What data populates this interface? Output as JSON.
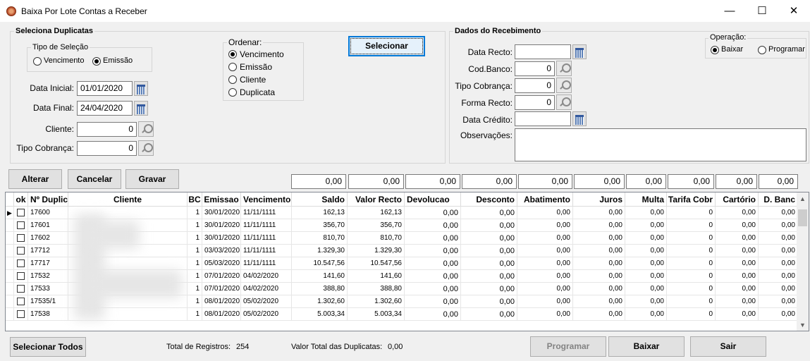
{
  "window": {
    "title": "Baixa Por Lote Contas a Receber",
    "minimize": "—",
    "maximize": "☐",
    "close": "✕"
  },
  "seleciona": {
    "title": "Seleciona Duplicatas",
    "tipo_selecao_title": "Tipo de Seleção",
    "tipo_selecao_options": [
      "Vencimento",
      "Emissão"
    ],
    "tipo_selecao_selected": "Emissão",
    "data_inicial_label": "Data Inicial:",
    "data_inicial": "01/01/2020",
    "data_final_label": "Data Final:",
    "data_final": "24/04/2020",
    "cliente_label": "Cliente:",
    "cliente": "0",
    "tipo_cobranca_label": "Tipo Cobrança:",
    "tipo_cobranca": "0",
    "ordenar_title": "Ordenar:",
    "ordenar_options": [
      "Vencimento",
      "Emissão",
      "Cliente",
      "Duplicata"
    ],
    "ordenar_selected": "Vencimento",
    "selecionar_label": "Selecionar"
  },
  "recebimento": {
    "title": "Dados do Recebimento",
    "data_recto_label": "Data Recto:",
    "data_recto": "",
    "cod_banco_label": "Cod.Banco:",
    "cod_banco": "0",
    "tipo_cobranca_label": "Tipo Cobrança:",
    "tipo_cobranca": "0",
    "forma_recto_label": "Forma Recto:",
    "forma_recto": "0",
    "data_credito_label": "Data Crédito:",
    "data_credito": "",
    "observacoes_label": "Observações:",
    "observacoes": "",
    "operacao_title": "Operação:",
    "operacao_options": [
      "Baixar",
      "Programar"
    ],
    "operacao_selected": "Baixar"
  },
  "actions": {
    "alterar": "Alterar",
    "cancelar": "Cancelar",
    "gravar": "Gravar"
  },
  "totals": [
    "0,00",
    "0,00",
    "0,00",
    "0,00",
    "0,00",
    "0,00",
    "0,00",
    "0,00",
    "0,00",
    "0,00"
  ],
  "table": {
    "headers": [
      "ok",
      "Nº Duplic",
      "Cliente",
      "BC",
      "Emissao",
      "Vencimento",
      "Saldo",
      "Valor Recto",
      "Devolucao",
      "Desconto",
      "Abatimento",
      "Juros",
      "Multa",
      "Tarifa Cobr",
      "Cartório",
      "D. Banc"
    ],
    "rows": [
      {
        "dup": "17600",
        "bc": "1",
        "emissao": "30/01/2020",
        "venc": "11/11/1111",
        "saldo": "162,13",
        "recto": "162,13",
        "devol": "0,00",
        "desc": "0,00",
        "abat": "0,00",
        "juros": "0,00",
        "multa": "0,00",
        "tarifa": "0",
        "cart": "0,00",
        "dbanc": "0,00"
      },
      {
        "dup": "17601",
        "bc": "1",
        "emissao": "30/01/2020",
        "venc": "11/11/1111",
        "saldo": "356,70",
        "recto": "356,70",
        "devol": "0,00",
        "desc": "0,00",
        "abat": "0,00",
        "juros": "0,00",
        "multa": "0,00",
        "tarifa": "0",
        "cart": "0,00",
        "dbanc": "0,00"
      },
      {
        "dup": "17602",
        "bc": "1",
        "emissao": "30/01/2020",
        "venc": "11/11/1111",
        "saldo": "810,70",
        "recto": "810,70",
        "devol": "0,00",
        "desc": "0,00",
        "abat": "0,00",
        "juros": "0,00",
        "multa": "0,00",
        "tarifa": "0",
        "cart": "0,00",
        "dbanc": "0,00"
      },
      {
        "dup": "17712",
        "bc": "1",
        "emissao": "03/03/2020",
        "venc": "11/11/1111",
        "saldo": "1.329,30",
        "recto": "1.329,30",
        "devol": "0,00",
        "desc": "0,00",
        "abat": "0,00",
        "juros": "0,00",
        "multa": "0,00",
        "tarifa": "0",
        "cart": "0,00",
        "dbanc": "0,00"
      },
      {
        "dup": "17717",
        "bc": "1",
        "emissao": "05/03/2020",
        "venc": "11/11/1111",
        "saldo": "10.547,56",
        "recto": "10.547,56",
        "devol": "0,00",
        "desc": "0,00",
        "abat": "0,00",
        "juros": "0,00",
        "multa": "0,00",
        "tarifa": "0",
        "cart": "0,00",
        "dbanc": "0,00"
      },
      {
        "dup": "17532",
        "bc": "1",
        "emissao": "07/01/2020",
        "venc": "04/02/2020",
        "saldo": "141,60",
        "recto": "141,60",
        "devol": "0,00",
        "desc": "0,00",
        "abat": "0,00",
        "juros": "0,00",
        "multa": "0,00",
        "tarifa": "0",
        "cart": "0,00",
        "dbanc": "0,00"
      },
      {
        "dup": "17533",
        "bc": "1",
        "emissao": "07/01/2020",
        "venc": "04/02/2020",
        "saldo": "388,80",
        "recto": "388,80",
        "devol": "0,00",
        "desc": "0,00",
        "abat": "0,00",
        "juros": "0,00",
        "multa": "0,00",
        "tarifa": "0",
        "cart": "0,00",
        "dbanc": "0,00"
      },
      {
        "dup": "17535/1",
        "bc": "1",
        "emissao": "08/01/2020",
        "venc": "05/02/2020",
        "saldo": "1.302,60",
        "recto": "1.302,60",
        "devol": "0,00",
        "desc": "0,00",
        "abat": "0,00",
        "juros": "0,00",
        "multa": "0,00",
        "tarifa": "0",
        "cart": "0,00",
        "dbanc": "0,00"
      },
      {
        "dup": "17538",
        "bc": "1",
        "emissao": "08/01/2020",
        "venc": "05/02/2020",
        "saldo": "5.003,34",
        "recto": "5.003,34",
        "devol": "0,00",
        "desc": "0,00",
        "abat": "0,00",
        "juros": "0,00",
        "multa": "0,00",
        "tarifa": "0",
        "cart": "0,00",
        "dbanc": "0,00"
      }
    ]
  },
  "footer": {
    "selecionar_todos": "Selecionar Todos",
    "total_registros_label": "Total de Registros:",
    "total_registros": "254",
    "valor_total_label": "Valor Total das Duplicatas:",
    "valor_total": "0,00",
    "programar": "Programar",
    "baixar": "Baixar",
    "sair": "Sair"
  }
}
